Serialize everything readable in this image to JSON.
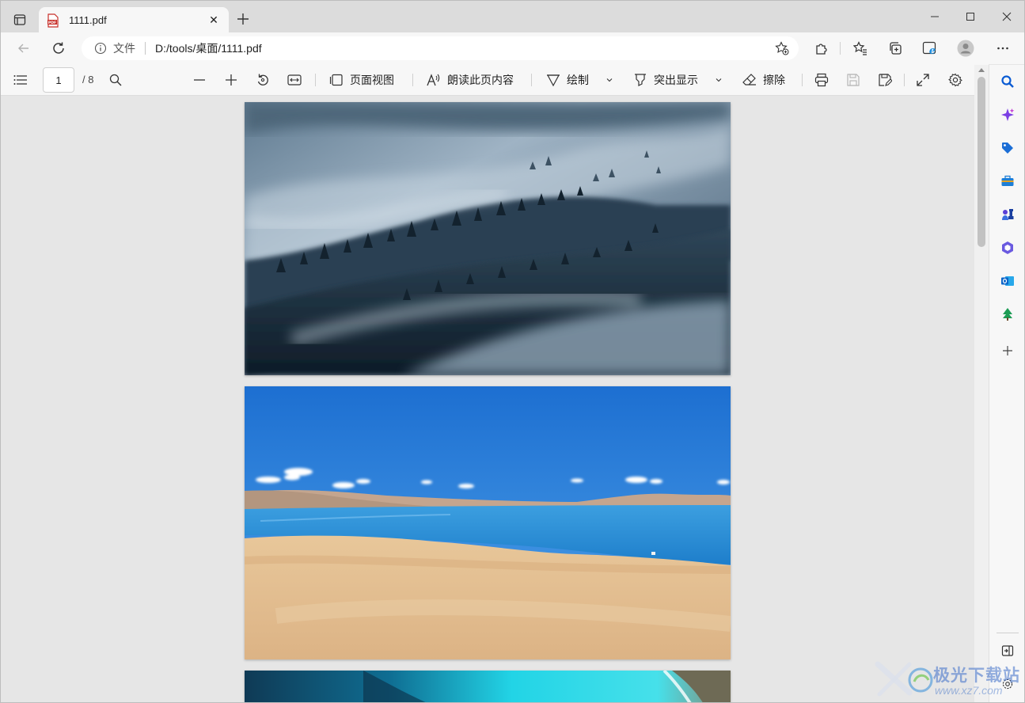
{
  "tab": {
    "title": "1111.pdf",
    "close": "✕"
  },
  "address": {
    "scheme_label": "文件",
    "url": "D:/tools/桌面/1111.pdf"
  },
  "pdf_toolbar": {
    "page_number": "1",
    "page_count": "/ 8",
    "page_view_label": "页面视图",
    "read_aloud_label": "朗读此页内容",
    "draw_label": "绘制",
    "highlight_label": "突出显示",
    "erase_label": "擦除"
  },
  "document": {
    "pages": [
      "foggy forest hills",
      "blue lake and sand dunes",
      "turquoise coastline"
    ]
  },
  "watermark": {
    "text": "极光下载站",
    "sub": "www.xz7.com"
  },
  "colors": {
    "accent": "#0a5bd3",
    "tabbar": "#dcdcdc",
    "toolbar": "#f7f7f7",
    "canvas": "#e6e6e6"
  }
}
